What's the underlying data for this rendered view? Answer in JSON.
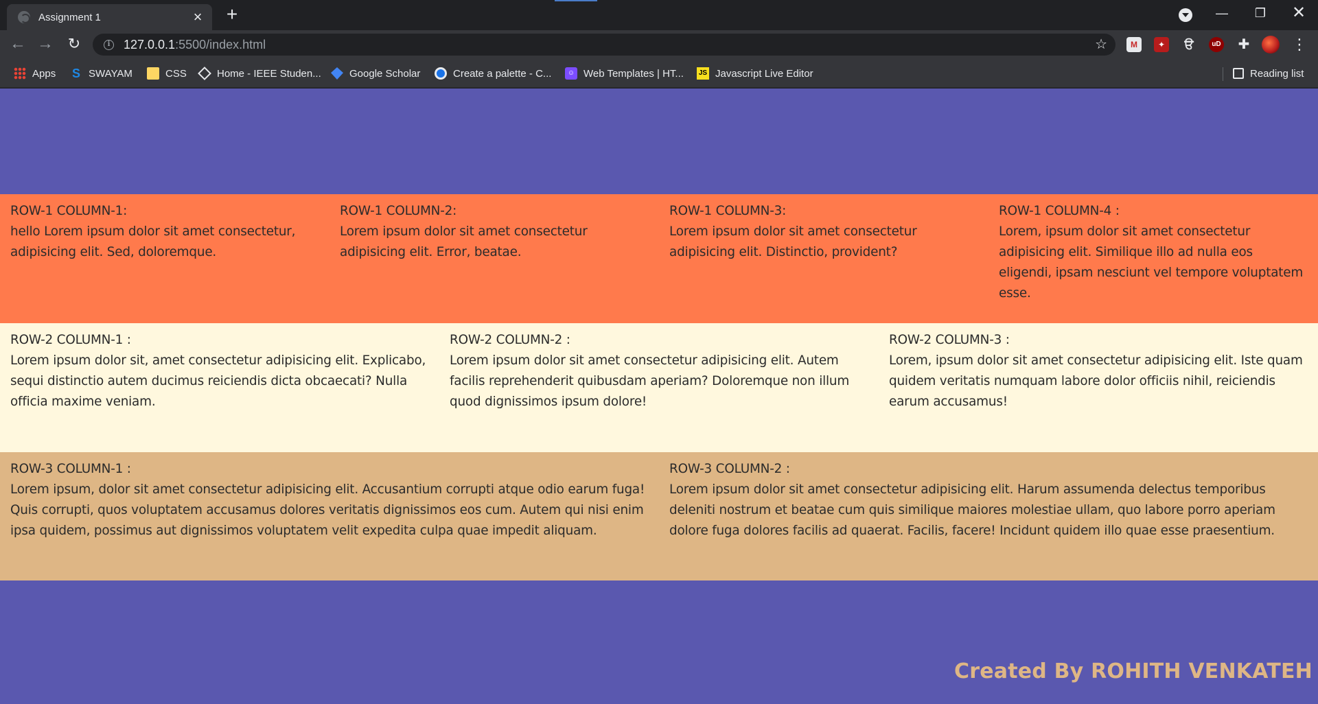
{
  "browser": {
    "tab": {
      "title": "Assignment 1"
    },
    "new_tab": "+",
    "window_controls": {
      "minimize": "—",
      "maximize": "❐",
      "close": "✕"
    },
    "address_bar": {
      "host": "127.0.0.1",
      "path": ":5500/index.html"
    },
    "bookmarks": [
      {
        "label": "Apps",
        "icon": "apps-grid-icon"
      },
      {
        "label": "SWAYAM",
        "icon": "swayam-icon"
      },
      {
        "label": "CSS",
        "icon": "folder-icon"
      },
      {
        "label": "Home - IEEE Studen...",
        "icon": "ieee-icon"
      },
      {
        "label": "Google Scholar",
        "icon": "scholar-icon"
      },
      {
        "label": "Create a palette - C...",
        "icon": "palette-icon"
      },
      {
        "label": "Web Templates | HT...",
        "icon": "templates-icon"
      },
      {
        "label": "Javascript Live Editor",
        "icon": "js-icon"
      }
    ],
    "reading_list": "Reading list",
    "extensions": [
      "mcafee-icon",
      "shield-ext-icon",
      "ext-icon",
      "ublock-icon",
      "puzzle-icon"
    ]
  },
  "page": {
    "row1": [
      {
        "head": "ROW-1 COLUMN-1:",
        "text": "hello Lorem ipsum dolor sit amet consectetur, adipisicing elit. Sed, doloremque."
      },
      {
        "head": "ROW-1 COLUMN-2:",
        "text": "Lorem ipsum dolor sit amet consectetur adipisicing elit. Error, beatae."
      },
      {
        "head": "ROW-1 COLUMN-3:",
        "text": "Lorem ipsum dolor sit amet consectetur adipisicing elit. Distinctio, provident?"
      },
      {
        "head": "ROW-1 COLUMN-4 :",
        "text": "Lorem, ipsum dolor sit amet consectetur adipisicing elit. Similique illo ad nulla eos eligendi, ipsam nesciunt vel tempore voluptatem esse."
      }
    ],
    "row2": [
      {
        "head": "ROW-2 COLUMN-1 :",
        "text": "Lorem ipsum dolor sit, amet consectetur adipisicing elit. Explicabo, sequi distinctio autem ducimus reiciendis dicta obcaecati? Nulla officia maxime veniam."
      },
      {
        "head": "ROW-2 COLUMN-2 :",
        "text": "Lorem ipsum dolor sit amet consectetur adipisicing elit. Autem facilis reprehenderit quibusdam aperiam? Doloremque non illum quod dignissimos ipsum dolore!"
      },
      {
        "head": "ROW-2 COLUMN-3 :",
        "text": "Lorem, ipsum dolor sit amet consectetur adipisicing elit. Iste quam quidem veritatis numquam labore dolor officiis nihil, reiciendis earum accusamus!"
      }
    ],
    "row3": [
      {
        "head": "ROW-3 COLUMN-1 :",
        "text": "Lorem ipsum, dolor sit amet consectetur adipisicing elit. Accusantium corrupti atque odio earum fuga! Quis corrupti, quos voluptatem accusamus dolores veritatis dignissimos eos cum. Autem qui nisi enim ipsa quidem, possimus aut dignissimos voluptatem velit expedita culpa quae impedit aliquam."
      },
      {
        "head": "ROW-3 COLUMN-2 :",
        "text": "Lorem ipsum dolor sit amet consectetur adipisicing elit. Harum assumenda delectus temporibus deleniti nostrum et beatae cum quis similique maiores molestiae ullam, quo labore porro aperiam dolore fuga dolores facilis ad quaerat. Facilis, facere! Incidunt quidem illo quae esse praesentium."
      }
    ],
    "footer": "Created By ROHITH VENKATEH"
  },
  "colors": {
    "page_bg": "#5a58af",
    "row1_bg": "#ff7a4c",
    "row2_bg": "#fff8de",
    "row3_bg": "#deb685",
    "footer_text": "#deb685"
  }
}
